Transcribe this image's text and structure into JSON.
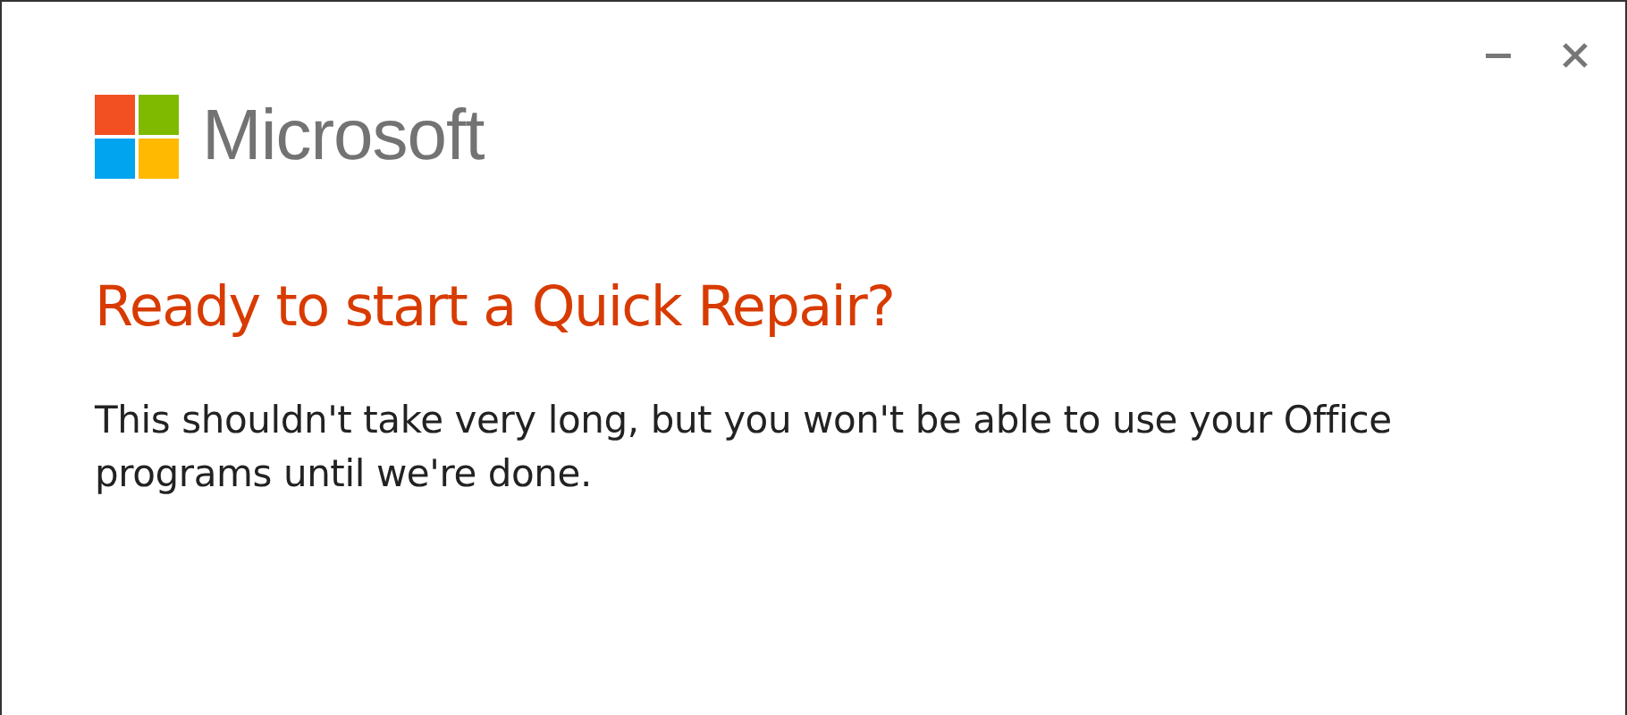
{
  "logo": {
    "text": "Microsoft"
  },
  "heading": "Ready to start a Quick Repair?",
  "message": "This shouldn't take very long, but you won't be able to use your Office programs until we're done."
}
